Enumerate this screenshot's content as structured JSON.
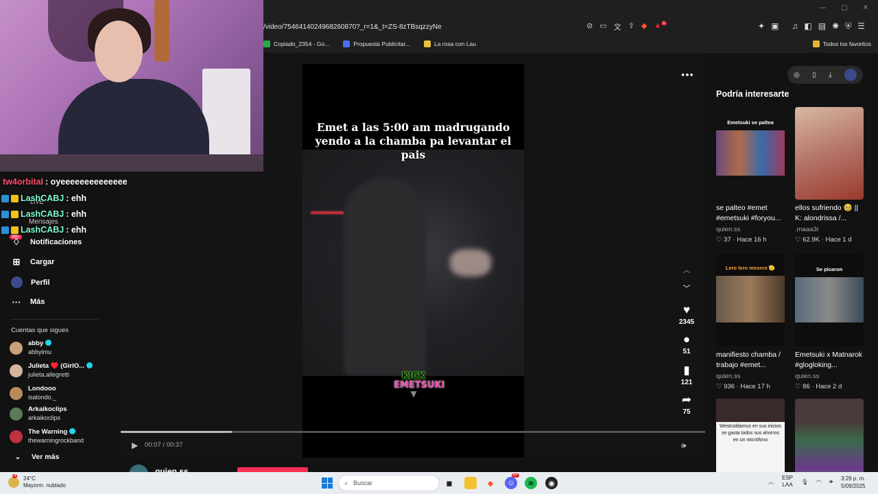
{
  "browser": {
    "url": "/video/7546414024968260870?_r=1&_t=ZS-8zTBsqzzyNe",
    "bookmarks": [
      {
        "label": "Copiado_2354 - Go...",
        "color": "#2aa84a"
      },
      {
        "label": "Propuesta Publicitar...",
        "color": "#4a6cf7"
      },
      {
        "label": "La rosa con Lau",
        "color": "#e6c040"
      }
    ],
    "bookmarks_right": "Todos los favoritos",
    "badge_count": "1"
  },
  "chat": {
    "messages": [
      {
        "user": "tw4orbital",
        "text": ": oyeeeeeeeeeeeeee",
        "user_color": "#ff4d6d"
      },
      {
        "user": "LashCABJ",
        "text": ": ehh",
        "user_color": "#7dfcd0"
      },
      {
        "user": "LashCABJ",
        "text": ": ehh",
        "user_color": "#7dfcd0"
      },
      {
        "user": "LashCABJ",
        "text": ": ehh",
        "user_color": "#7dfcd0"
      }
    ]
  },
  "sidebar": {
    "overlay_labels": {
      "live": "LIVE",
      "messages": "Mensajes",
      "badge": "99+"
    },
    "nav": [
      {
        "label": "Notificaciones",
        "icon": "bell-icon"
      },
      {
        "label": "Cargar",
        "icon": "upload-icon"
      },
      {
        "label": "Perfil",
        "icon": "profile-icon"
      },
      {
        "label": "Más",
        "icon": "more-icon"
      }
    ],
    "following_title": "Cuentas que sigues",
    "accounts": [
      {
        "name": "abby",
        "handle": "abbyimu",
        "verified": true,
        "color": "#c9a07a"
      },
      {
        "name": "Julieta ♥️ (GirlO...",
        "handle": "julieta.allegretti",
        "verified": true,
        "color": "#d8b4a0"
      },
      {
        "name": "Londooo",
        "handle": "isalondo._",
        "verified": false,
        "color": "#b98a5a"
      },
      {
        "name": "Arkaikoclips",
        "handle": "arkaikoclips",
        "verified": false,
        "color": "#5a7a5a"
      },
      {
        "name": "The Warning",
        "handle": "thewarningrockband",
        "verified": true,
        "color": "#c03040"
      }
    ],
    "see_more": "Ver más"
  },
  "video": {
    "caption_line1": "Emet a las 5:00 am madrugando",
    "caption_line2": "yendo a la chamba pa levantar el pais",
    "logo_top": "KICK",
    "logo_bottom": "EMETSUKI",
    "likes": "2345",
    "comments": "51",
    "saves": "121",
    "shares": "75",
    "time": "00:07 / 00:37",
    "progress": 0.19,
    "author": "quien.ss"
  },
  "recommendations": {
    "title": "Podría interesarte",
    "cards": [
      {
        "title": "se palteo #emet #emetsuki #foryou...",
        "author": "quien.ss",
        "likes": "37",
        "age": "Hace 16 h",
        "band": "Emetsuki se paltea",
        "bg": "#f1eef0",
        "img": "#6a4a7a"
      },
      {
        "title": "ellos sufriendo 🥹 || K: alondrissa /...",
        "author": ".maaa3r",
        "likes": "62.9K",
        "age": "Hace 1 d",
        "band": "",
        "bg": "#c4a08c",
        "img": "#8a4a3a"
      },
      {
        "title": "manifiesto chamba / trabajo #emet...",
        "author": "quien.ss",
        "likes": "936",
        "age": "Hace 17 h",
        "band": "Lero lero mesero 🫡",
        "bg": "#0d0d0d",
        "img": "#7a5a3a"
      },
      {
        "title": "Emetsuki x Matnarok #glogloking...",
        "author": "quien.ss",
        "likes": "86",
        "age": "Hace 2 d",
        "band": "Se picaron",
        "bg": "#0d0d0d",
        "img": "#5a6a7a"
      },
      {
        "title": "",
        "author": "",
        "likes": "",
        "age": "",
        "band": "Westcoldamus en sus inicios se gasta todos sus ahorros en un micrófono",
        "bg": "#f4f4f4",
        "img": "#222"
      },
      {
        "title": "",
        "author": "",
        "likes": "",
        "age": "",
        "band": "",
        "bg": "#3a5a3a",
        "img": "#4a2a6a"
      }
    ]
  },
  "taskbar": {
    "weather_temp": "24°C",
    "weather_desc": "Mayorm. nublado",
    "weather_badge": "4",
    "search_placeholder": "Buscar",
    "lang": "ESP",
    "lang2": "LAA",
    "time": "3:29 p. m.",
    "date": "5/09/2025",
    "discord_badge": "9+"
  }
}
